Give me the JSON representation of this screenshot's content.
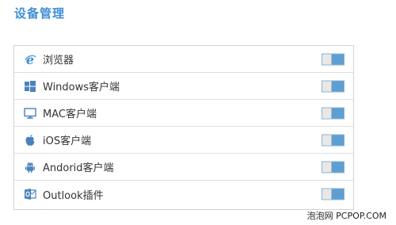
{
  "page": {
    "title": "设备管理"
  },
  "devices": [
    {
      "label": "浏览器",
      "icon": "internet-explorer-icon",
      "enabled": true
    },
    {
      "label": "Windows客户端",
      "icon": "windows-icon",
      "enabled": true
    },
    {
      "label": "MAC客户端",
      "icon": "monitor-icon",
      "enabled": true
    },
    {
      "label": "iOS客户端",
      "icon": "apple-icon",
      "enabled": true
    },
    {
      "label": "Andorid客户端",
      "icon": "android-icon",
      "enabled": true
    },
    {
      "label": "Outlook插件",
      "icon": "outlook-icon",
      "enabled": true
    }
  ],
  "colors": {
    "accent": "#3f8fd6",
    "toggle_on": "#5d9fd2",
    "icon": "#4a82bb"
  },
  "watermark": "泡泡网 PCPOP.COM"
}
